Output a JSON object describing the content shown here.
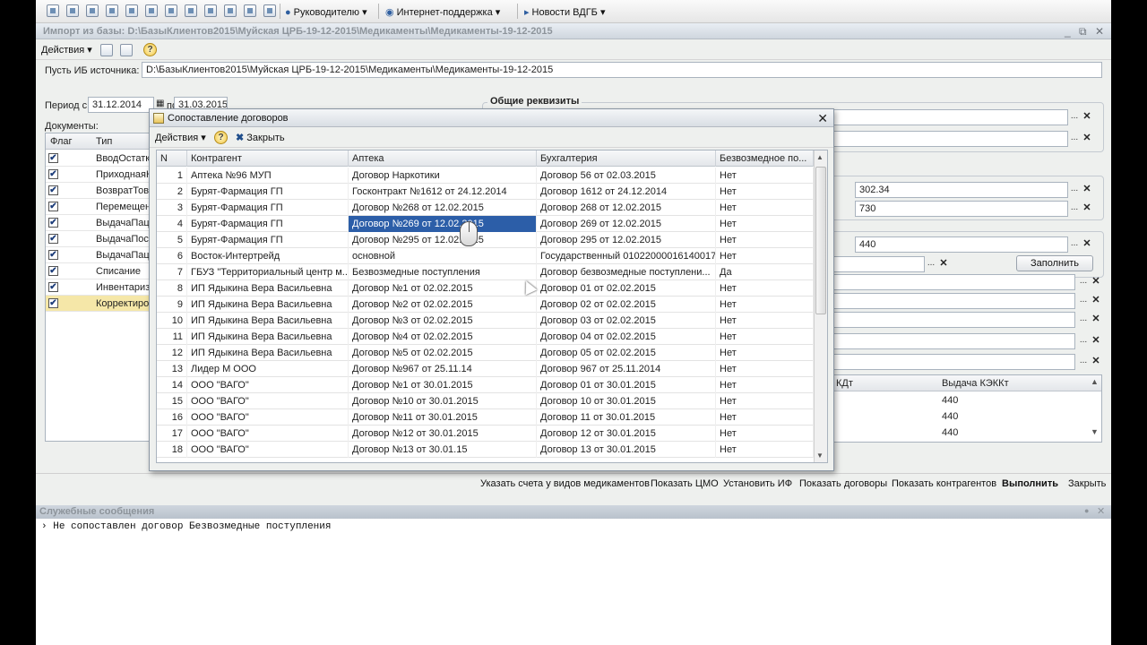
{
  "toolbar": {
    "menu1": "Руководителю",
    "menu2": "Интернет-поддержка",
    "menu3": "Новости ВДГБ"
  },
  "main": {
    "title": "Импорт из базы: D:\\БазыКлиентов2015\\Муйская ЦРБ-19-12-2015\\Медикаменты\\Медикаменты-19-12-2015",
    "actions": "Действия",
    "source_label": "Пусть ИБ источника:",
    "source_value": "D:\\БазыКлиентов2015\\Муйская ЦРБ-19-12-2015\\Медикаменты\\Медикаменты-19-12-2015",
    "period_label": "Период с",
    "period_from": "31.12.2014",
    "period_to_label": "по",
    "period_to": "31.03.2015",
    "general_group": "Общие реквизиты",
    "documents_label": "Документы:",
    "doc_head_flag": "Флаг",
    "doc_head_type": "Тип",
    "docs": [
      "ВводОстатк",
      "ПриходнаяН",
      "ВозвратТов",
      "Перемещен",
      "ВыдачаПаци",
      "ВыдачаПост",
      "ВыдачаПаци",
      "Списание",
      "Инвентариз",
      "Корректиро"
    ],
    "field_a": "302.34",
    "field_b": "730",
    "field_c": "440",
    "fill_button": "Заполнить",
    "rtable_head_left": "КДт",
    "rtable_head_right": "Выдача КЭККт",
    "rtable_values": [
      "440",
      "440",
      "440"
    ]
  },
  "bottom": {
    "cmd1": "Указать счета у видов медикаментов",
    "cmd2": "Показать ЦМО",
    "cmd3": "Установить ИФ",
    "cmd4": "Показать договоры",
    "cmd5": "Показать контрагентов",
    "cmd6": "Выполнить",
    "cmd7": "Закрыть"
  },
  "messages": {
    "title": "Служебные сообщения",
    "line": "Не сопоставлен договор Безвозмедные поступления"
  },
  "dialog": {
    "title": "Сопоставление договоров",
    "actions": "Действия",
    "close": "Закрыть",
    "columns": [
      "N",
      "Контрагент",
      "Аптека",
      "Бухгалтерия",
      "Безвозмедное по..."
    ],
    "rows": [
      [
        "1",
        "Аптека №96  МУП",
        "Договор Наркотики",
        "Договор 56 от 02.03.2015",
        "Нет"
      ],
      [
        "2",
        "Бурят-Фармация  ГП",
        "Госконтракт №1612 от 24.12.2014",
        "Договор 1612 от 24.12.2014",
        "Нет"
      ],
      [
        "3",
        "Бурят-Фармация  ГП",
        "Договор №268 от 12.02.2015",
        "Договор 268 от 12.02.2015",
        "Нет"
      ],
      [
        "4",
        "Бурят-Фармация  ГП",
        "Договор №269 от 12.02.2015",
        "Договор 269 от 12.02.2015",
        "Нет"
      ],
      [
        "5",
        "Бурят-Фармация  ГП",
        "Договор №295 от 12.02.2015",
        "Договор 295 от 12.02.2015",
        "Нет"
      ],
      [
        "6",
        "Восток-Интертрейд",
        "основной",
        "Государственный 01022000016140017...",
        "Нет"
      ],
      [
        "7",
        "ГБУЗ \"Территориальный центр м...",
        "Безвозмедные поступления",
        "Договор безвозмедные поступлени...",
        "Да"
      ],
      [
        "8",
        "ИП Ядыкина Вера Васильевна",
        "Договор №1 от 02.02.2015",
        "Договор 01 от 02.02.2015",
        "Нет"
      ],
      [
        "9",
        "ИП Ядыкина Вера Васильевна",
        "Договор №2 от 02.02.2015",
        "Договор 02 от 02.02.2015",
        "Нет"
      ],
      [
        "10",
        "ИП Ядыкина Вера Васильевна",
        "Договор №3 от 02.02.2015",
        "Договор 03 от 02.02.2015",
        "Нет"
      ],
      [
        "11",
        "ИП Ядыкина Вера Васильевна",
        "Договор №4 от 02.02.2015",
        "Договор 04 от 02.02.2015",
        "Нет"
      ],
      [
        "12",
        "ИП Ядыкина Вера Васильевна",
        "Договор №5 от 02.02.2015",
        "Договор 05 от 02.02.2015",
        "Нет"
      ],
      [
        "13",
        "Лидер М ООО",
        "Договор №967 от 25.11.14",
        "Договор 967 от 25.11.2014",
        "Нет"
      ],
      [
        "14",
        "ООО \"ВАГО\"",
        "Договор №1 от 30.01.2015",
        "Договор 01 от 30.01.2015",
        "Нет"
      ],
      [
        "15",
        "ООО \"ВАГО\"",
        "Договор №10 от 30.01.2015",
        "Договор 10 от 30.01.2015",
        "Нет"
      ],
      [
        "16",
        "ООО \"ВАГО\"",
        "Договор №11 от 30.01.2015",
        "Договор 11 от 30.01.2015",
        "Нет"
      ],
      [
        "17",
        "ООО \"ВАГО\"",
        "Договор №12 от 30.01.2015",
        "Договор 12 от 30.01.2015",
        "Нет"
      ],
      [
        "18",
        "ООО \"ВАГО\"",
        "Договор №13 от 30.01.15",
        "Договор 13 от 30.01.2015",
        "Нет"
      ]
    ],
    "selected_row": 4,
    "selected_col": 2
  }
}
